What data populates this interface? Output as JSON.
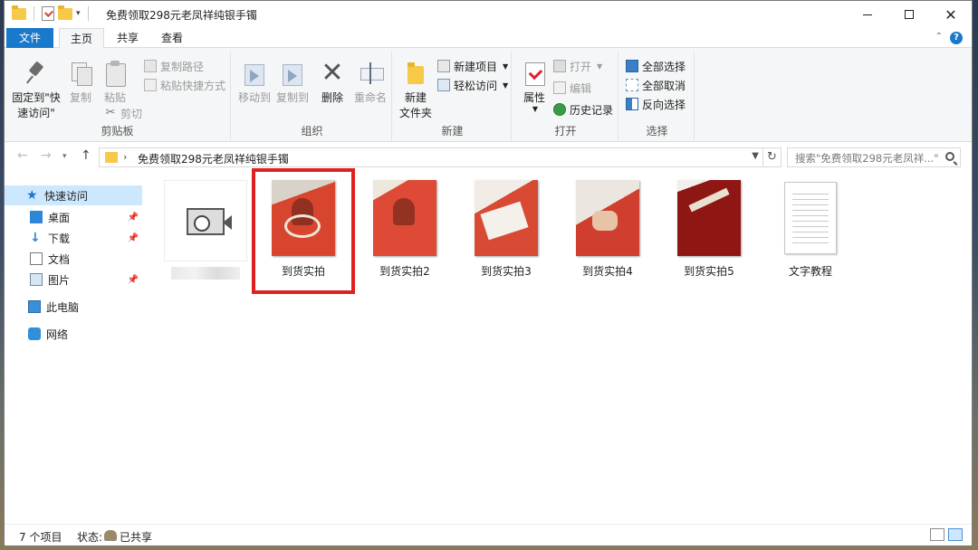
{
  "window": {
    "title": "免费领取298元老凤祥纯银手镯"
  },
  "tabs": {
    "file": "文件",
    "home": "主页",
    "share": "共享",
    "view": "查看"
  },
  "ribbon": {
    "clipboard": {
      "label": "剪贴板",
      "pin": "固定到\"快\n速访问\"",
      "pin_l1": "固定到\"快",
      "pin_l2": "速访问\"",
      "copy": "复制",
      "paste": "粘贴",
      "copy_path": "复制路径",
      "paste_shortcut": "粘贴快捷方式",
      "cut": "剪切"
    },
    "organize": {
      "label": "组织",
      "move_to": "移动到",
      "copy_to": "复制到",
      "delete": "删除",
      "rename": "重命名"
    },
    "new": {
      "label": "新建",
      "new_folder_l1": "新建",
      "new_folder_l2": "文件夹",
      "new_item": "新建项目",
      "easy_access": "轻松访问"
    },
    "open": {
      "label": "打开",
      "properties": "属性",
      "open": "打开",
      "edit": "编辑",
      "history": "历史记录"
    },
    "select": {
      "label": "选择",
      "select_all": "全部选择",
      "select_none": "全部取消",
      "invert": "反向选择"
    }
  },
  "address": {
    "path": "免费领取298元老凤祥纯银手镯",
    "search_placeholder": "搜索\"免费领取298元老凤祥...\""
  },
  "nav": {
    "quick_access": "快速访问",
    "desktop": "桌面",
    "downloads": "下载",
    "documents": "文档",
    "pictures": "图片",
    "this_pc": "此电脑",
    "network": "网络"
  },
  "files": [
    {
      "name": "",
      "type": "video"
    },
    {
      "name": "到货实拍",
      "type": "image"
    },
    {
      "name": "到货实拍2",
      "type": "image"
    },
    {
      "name": "到货实拍3",
      "type": "image"
    },
    {
      "name": "到货实拍4",
      "type": "image"
    },
    {
      "name": "到货实拍5",
      "type": "image"
    },
    {
      "name": "文字教程",
      "type": "text"
    }
  ],
  "status": {
    "count": "7 个项目",
    "state_label": "状态:",
    "state_value": "已共享"
  },
  "colors": {
    "accent": "#1979ca",
    "highlight": "#e02020",
    "selection": "#cce8ff"
  }
}
